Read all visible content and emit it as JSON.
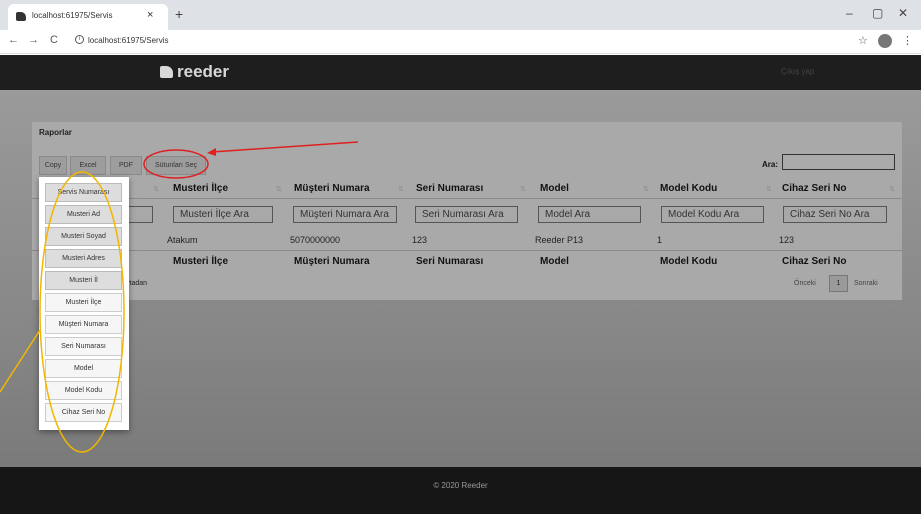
{
  "browser": {
    "tab_title": "localhost:61975/Servis",
    "tab_close": "×",
    "new_tab": "+",
    "url": "localhost:61975/Servis",
    "info": "i",
    "back": "←",
    "forward": "→",
    "reload": "C",
    "star": "☆",
    "kebab": "⋮",
    "minimize": "–",
    "maximize": "▢",
    "close": "✕"
  },
  "navbar": {
    "brand": "reeder",
    "logout": "Çıkış yap"
  },
  "panel": {
    "title": "Raporlar",
    "buttons": [
      "Copy",
      "Excel",
      "PDF",
      "Sütunları Seç"
    ],
    "search_label": "Ara:"
  },
  "table": {
    "headers": [
      "Musteri İlçe",
      "Müşteri Numara",
      "Seri Numarası",
      "Model",
      "Model Kodu",
      "Cihaz Seri No"
    ],
    "filters": [
      "Musteri İlçe Ara",
      "Müşteri Numara Ara",
      "Seri Numarası Ara",
      "Model Ara",
      "Model Kodu Ara",
      "Cihaz Seri No Ara"
    ],
    "row": [
      "Atakum",
      "5070000000",
      "123",
      "Reeder P13",
      "1",
      "123"
    ],
    "footer_headers": [
      "Musteri İlçe",
      "Müşteri Numara",
      "Seri Numarası",
      "Model",
      "Model Kodu",
      "Cihaz Seri No"
    ],
    "info_fragment": "ytadan"
  },
  "pagination": {
    "prev": "Önceki",
    "page": "1",
    "next": "Sonraki"
  },
  "column_menu": {
    "options": [
      "Servis Numarası",
      "Musteri Ad",
      "Musteri Soyad",
      "Musteri Adres",
      "Musteri İl",
      "Musteri İlçe",
      "Müşteri Numara",
      "Seri Numarası",
      "Model",
      "Model Kodu",
      "Cihaz Seri No"
    ]
  },
  "footer": {
    "copyright": "© 2020 Reeder"
  },
  "colors": {
    "annotation_red": "#e02020",
    "annotation_yellow": "#f2b600"
  }
}
